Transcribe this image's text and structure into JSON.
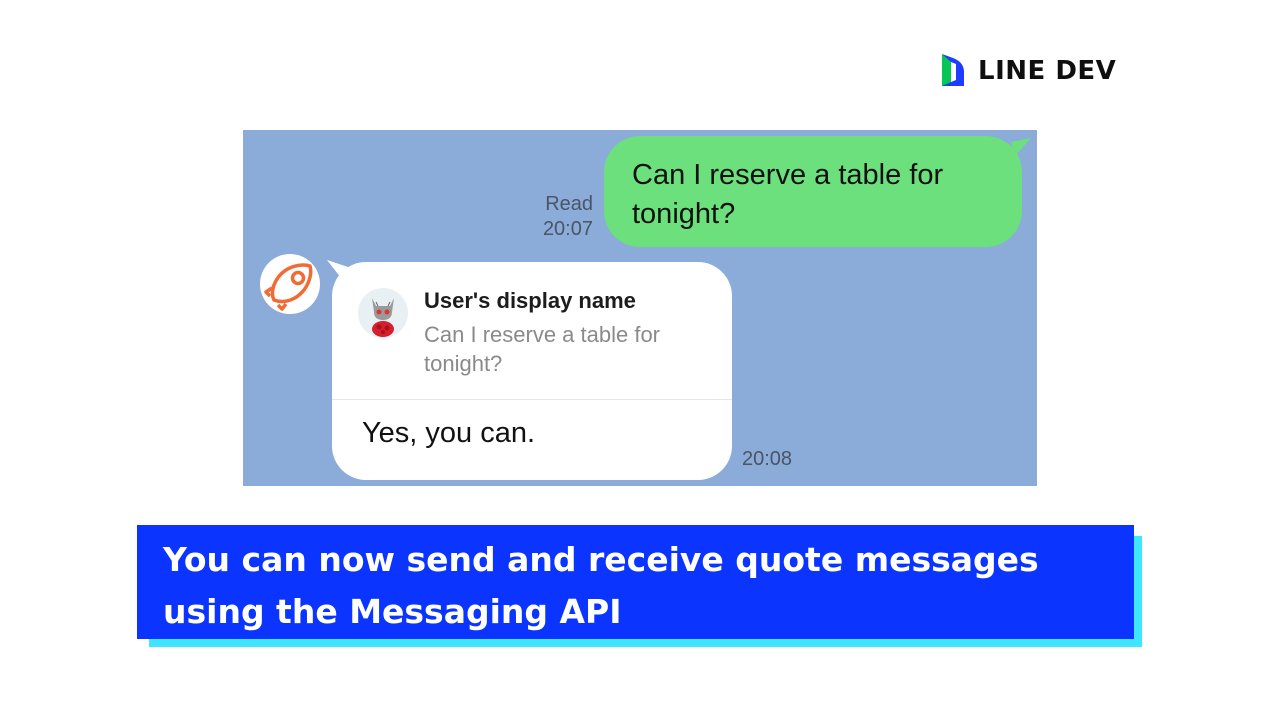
{
  "logo": {
    "text": "LINE DEV",
    "icon": "line-dev-logo-icon",
    "colors": [
      "#06c755",
      "#1e3cff"
    ]
  },
  "chat": {
    "background_color": "#8babd8",
    "outgoing": {
      "text": "Can I reserve a table for tonight?",
      "status": "Read",
      "time": "20:07",
      "bubble_color": "#6ce07c"
    },
    "incoming": {
      "sender_avatar_icon": "rocket-icon",
      "quote": {
        "name": "User's display name",
        "text": "Can I reserve a table for tonight?",
        "avatar_icon": "cat-avatar-icon"
      },
      "reply": "Yes, you can.",
      "time": "20:08"
    }
  },
  "banner": {
    "line1": "You can now send and receive quote messages",
    "line2": "using the Messaging API",
    "background_color": "#0b35ff",
    "shadow_color": "#3ee6ff"
  }
}
